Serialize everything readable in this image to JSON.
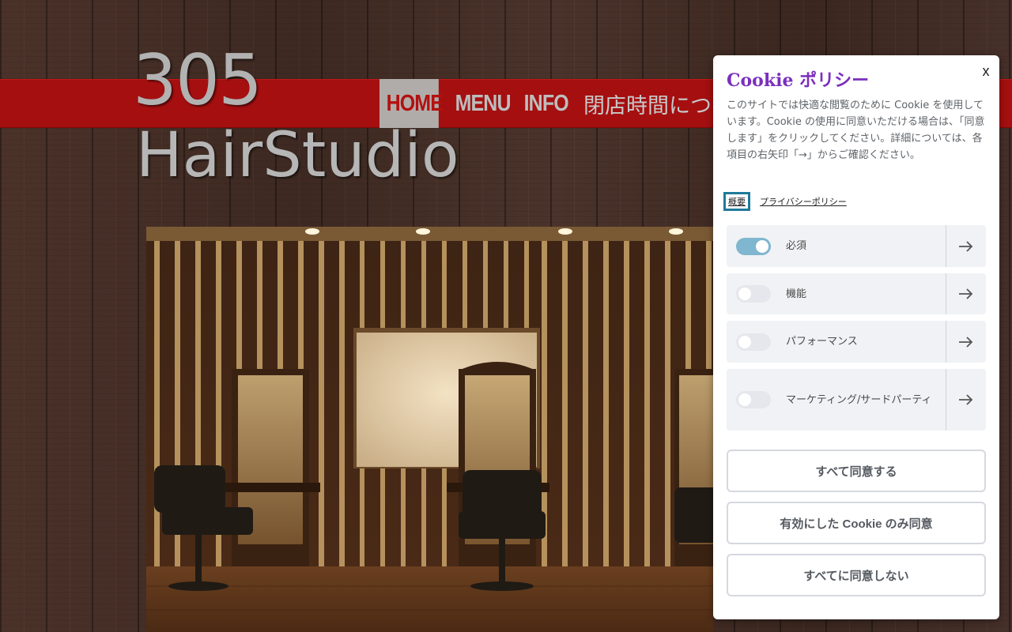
{
  "site": {
    "logo_number": "305",
    "logo_name": "HairStudio",
    "nav": [
      {
        "label": "HOME",
        "active": true
      },
      {
        "label": "MENU",
        "active": false
      },
      {
        "label": "INFO",
        "active": false
      }
    ],
    "nav_hours": "閉店時間につ"
  },
  "hero": {
    "alt": "salon interior photo"
  },
  "cookie": {
    "title": "Cookie ポリシー",
    "close_label": "x",
    "description": "このサイトでは快適な閲覧のために Cookie を使用しています。Cookie の使用に同意いただける場合は、「同意します」をクリックしてください。詳細については、各項目の右矢印「→」からご確認ください。",
    "tabs": {
      "overview": "概要",
      "privacy": "プライバシーポリシー"
    },
    "categories": [
      {
        "label": "必須",
        "enabled": true
      },
      {
        "label": "機能",
        "enabled": false
      },
      {
        "label": "パフォーマンス",
        "enabled": false
      },
      {
        "label": "マーケティング/サードパーティ",
        "enabled": false
      }
    ],
    "buttons": {
      "accept_all": "すべて同意する",
      "accept_selected": "有効にした Cookie のみ同意",
      "reject_all": "すべてに同意しない"
    }
  },
  "colors": {
    "nav_band": "#a50f10",
    "cookie_title": "#7b2fbe",
    "toggle_on": "#7fb6d0",
    "tab_focus": "#1f7a9a"
  },
  "icons": [
    "arrow-right-icon",
    "close-icon"
  ]
}
